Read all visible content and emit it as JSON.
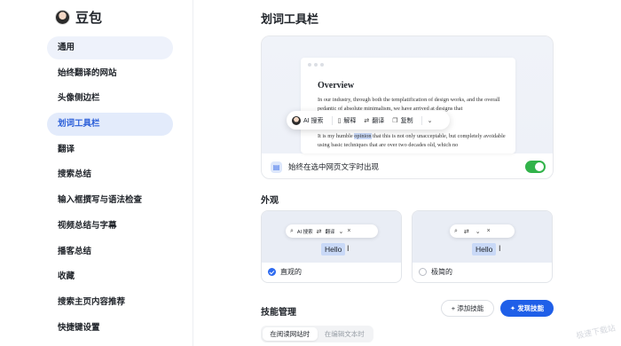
{
  "app": {
    "name": "豆包"
  },
  "sidebar": {
    "items": [
      {
        "label": "通用"
      },
      {
        "label": "始终翻译的网站"
      },
      {
        "label": "头像侧边栏"
      },
      {
        "label": "划词工具栏"
      },
      {
        "label": "翻译"
      },
      {
        "label": "搜索总结"
      },
      {
        "label": "输入框撰写与语法检查"
      },
      {
        "label": "视频总结与字幕"
      },
      {
        "label": "播客总结"
      },
      {
        "label": "收藏"
      },
      {
        "label": "搜索主页内容推荐"
      },
      {
        "label": "快捷键设置"
      }
    ],
    "active_index": 3
  },
  "main": {
    "title": "划词工具栏",
    "preview": {
      "doc_title": "Overview",
      "para1": "In our industry, through both the templatification of design works, and the overall pedantic of absolute minimalism, we have arrived at designs that",
      "para2_before": "It is my humble ",
      "para2_selected": "opinion",
      "para2_after": " that this is not only unacceptable, but completely avoidable using basic techniques that are over two decades old, which no",
      "toolbar": {
        "ai_search": "AI 搜索",
        "explain": "解释",
        "translate": "翻译",
        "copy": "复制"
      },
      "footer_text": "始终在选中网页文字时出现",
      "toggle_on": true
    },
    "appearance": {
      "title": "外观",
      "options": [
        {
          "label": "直观的",
          "selected": true,
          "bar_ai": "AI 搜索",
          "bar_translate": "翻译",
          "hello": "Hello"
        },
        {
          "label": "极简的",
          "selected": false,
          "hello": "Hello"
        }
      ]
    },
    "skills": {
      "title": "技能管理",
      "add_label": "添加技能",
      "discover_label": "发现技能",
      "tabs": [
        "在阅读网站时",
        "在编辑文本时"
      ],
      "active_tab": 0
    }
  },
  "watermark": "极速下载站"
}
